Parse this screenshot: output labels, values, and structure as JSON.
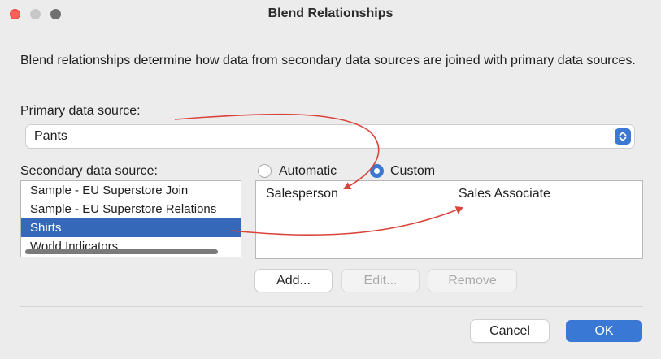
{
  "window": {
    "title": "Blend Relationships"
  },
  "description": "Blend relationships determine how data from secondary data sources are joined with primary data sources.",
  "primary": {
    "label": "Primary data source:",
    "selected": "Pants"
  },
  "secondary": {
    "label": "Secondary data source:",
    "items": [
      {
        "label": "Sample - EU Superstore Join",
        "selected": false
      },
      {
        "label": "Sample - EU Superstore Relations",
        "selected": false
      },
      {
        "label": "Shirts",
        "selected": true
      },
      {
        "label": "World Indicators",
        "selected": false
      }
    ]
  },
  "relationship_mode": {
    "automatic_label": "Automatic",
    "custom_label": "Custom",
    "selected": "Custom"
  },
  "mapping": {
    "primary_field": "Salesperson",
    "secondary_field": "Sales Associate"
  },
  "buttons": {
    "add": "Add...",
    "edit": "Edit...",
    "remove": "Remove",
    "cancel": "Cancel",
    "ok": "OK"
  },
  "colors": {
    "accent": "#3b78d4",
    "selection": "#3568b8",
    "annotation_arrow": "#d9453c"
  }
}
